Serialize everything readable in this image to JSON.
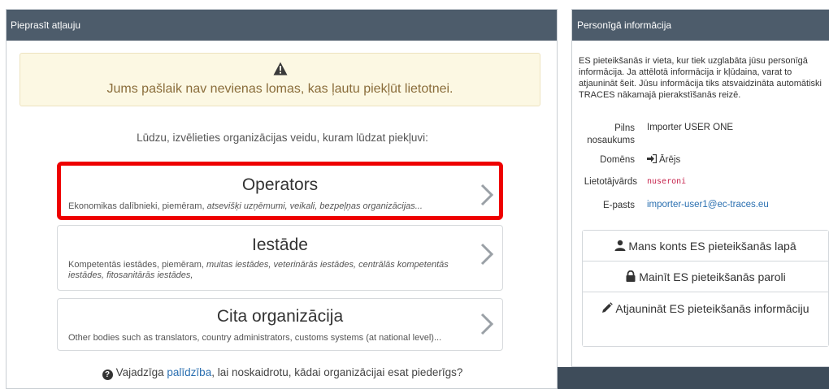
{
  "left_panel": {
    "header": "Pieprasīt atļauju",
    "alert_text": "Jums pašlaik nav nevienas lomas, kas ļautu piekļūt lietotnei.",
    "choose_text": "Lūdzu, izvēlieties organizācijas veidu, kuram lūdzat piekļuvi:",
    "cards": [
      {
        "title": "Operators",
        "desc_plain": "Ekonomikas dalībnieki, piemēram, ",
        "desc_italic": "atsevišķi uzņēmumi, veikali, bezpeļņas organizācijas..."
      },
      {
        "title": "Iestāde",
        "desc_plain": "Kompetentās iestādes, piemēram, ",
        "desc_italic": "muitas iestādes, veterinārās iestādes, centrālās kompetentās iestādes, fitosanitārās iestādes,"
      },
      {
        "title": "Cita organizācija",
        "desc_plain": "Other bodies such as translators, country administrators, customs systems (at national level)...",
        "desc_italic": ""
      }
    ],
    "help": {
      "prefix": "Vajadzīga ",
      "link": "palīdzība",
      "suffix": ", lai noskaidrotu, kādai organizācijai esat piederīgs?"
    }
  },
  "right_panel": {
    "header": "Personīgā informācija",
    "intro": "ES pieteikšanās ir vieta, kur tiek uzglabāta jūsu personīgā informācija. Ja attēlotā informācija ir kļūdaina, varat to atjaunināt šeit. Jūsu informācija tiks atsvaidzināta automātiski TRACES nākamajā pierakstīšanās reizē.",
    "fields": {
      "full_name_label": "Pilns nosaukums",
      "full_name_value": "Importer USER ONE",
      "domain_label": "Domēns",
      "domain_value": "Ārējs",
      "username_label": "Lietotājvārds",
      "username_value": "nuseroni",
      "email_label": "E-pasts",
      "email_value": "importer-user1@ec-traces.eu"
    },
    "buttons": {
      "account": "Mans konts ES pieteikšanās lapā",
      "password": "Mainīt ES pieteikšanās paroli",
      "update": "Atjaunināt ES pieteikšanās informāciju"
    }
  },
  "colors": {
    "header_bg": "#4d5c6b",
    "alert_bg": "#fcf8e3",
    "alert_text": "#8a6d3b",
    "highlight": "#ee0000",
    "link": "#2a6fb0"
  }
}
